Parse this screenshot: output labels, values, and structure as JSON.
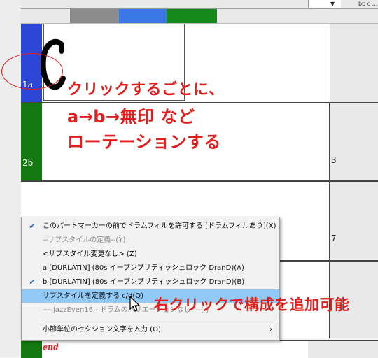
{
  "toolbar": {
    "dropdown_arrow": "▼",
    "right_text": "bb c ..."
  },
  "colors": {
    "blue": "#2c46d8",
    "green": "#12780f",
    "red": "#e31d1d",
    "highlight": "#91c9f7"
  },
  "rows": [
    {
      "label": "1a",
      "measure": ""
    },
    {
      "label": "2b",
      "measure": "3"
    },
    {
      "label": "",
      "measure": "7"
    },
    {
      "label": "",
      "measure": ""
    }
  ],
  "end_label": "end",
  "annotation_top": {
    "line1": "クリックするごとに、",
    "line2": "a→b→無印 など",
    "line3": "ローテーションする"
  },
  "annotation_menu": "右クリックで構成を追加可能",
  "menu": {
    "items": [
      {
        "label": "このパートマーカーの前でドラムフィルを許可する [ドラムフィルあり](X)",
        "checked": true,
        "disabled": false
      },
      {
        "label": "--サブスタイルの定義--(Y)",
        "checked": false,
        "disabled": true
      },
      {
        "label": "<サブスタイル変更なし>   (Z)",
        "checked": false,
        "disabled": false
      },
      {
        "label": "a    [DURLATIN]    (80s イーブンブリティッシュロック DranD)(A)",
        "checked": false,
        "disabled": false
      },
      {
        "label": "b    [DURLATIN]    (80s イーブンブリティッシュロック DranD)(B)",
        "checked": true,
        "disabled": false
      },
      {
        "label": "サブスタイルを定義する c/d(Q)",
        "checked": false,
        "disabled": false,
        "highlight": true
      },
      {
        "label": "----JazzEven16 - ドラムのバリエーションなし----(-)",
        "checked": false,
        "disabled": true
      },
      {
        "label": "小節単位のセクション文字を入力 (O)",
        "checked": false,
        "disabled": false,
        "submenu": true
      }
    ]
  }
}
